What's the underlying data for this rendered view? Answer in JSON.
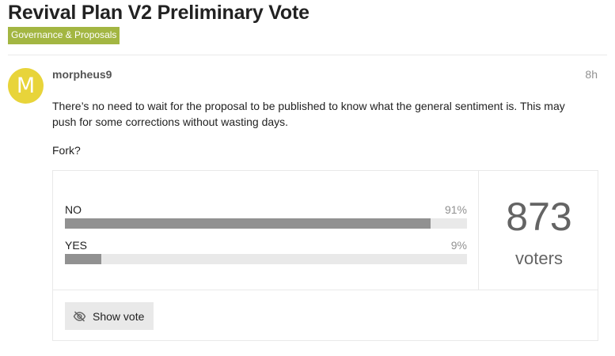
{
  "topic": {
    "title": "Revival Plan V2 Preliminary Vote",
    "category": "Governance & Proposals",
    "category_color": "#a3b642"
  },
  "post": {
    "avatar_letter": "M",
    "avatar_color": "#e8d43a",
    "username": "morpheus9",
    "age": "8h",
    "paragraphs": [
      "There’s no need to wait for the proposal to be published to know what the general sentiment is. This may push for some corrections without wasting days.",
      "Fork?"
    ]
  },
  "poll": {
    "options": [
      {
        "label": "NO",
        "percent_text": "91%",
        "percent": 91
      },
      {
        "label": "YES",
        "percent_text": "9%",
        "percent": 9
      }
    ],
    "voter_count": "873",
    "voter_label": "voters",
    "show_vote_label": "Show vote",
    "show_vote_icon": "eye-slash-icon"
  }
}
